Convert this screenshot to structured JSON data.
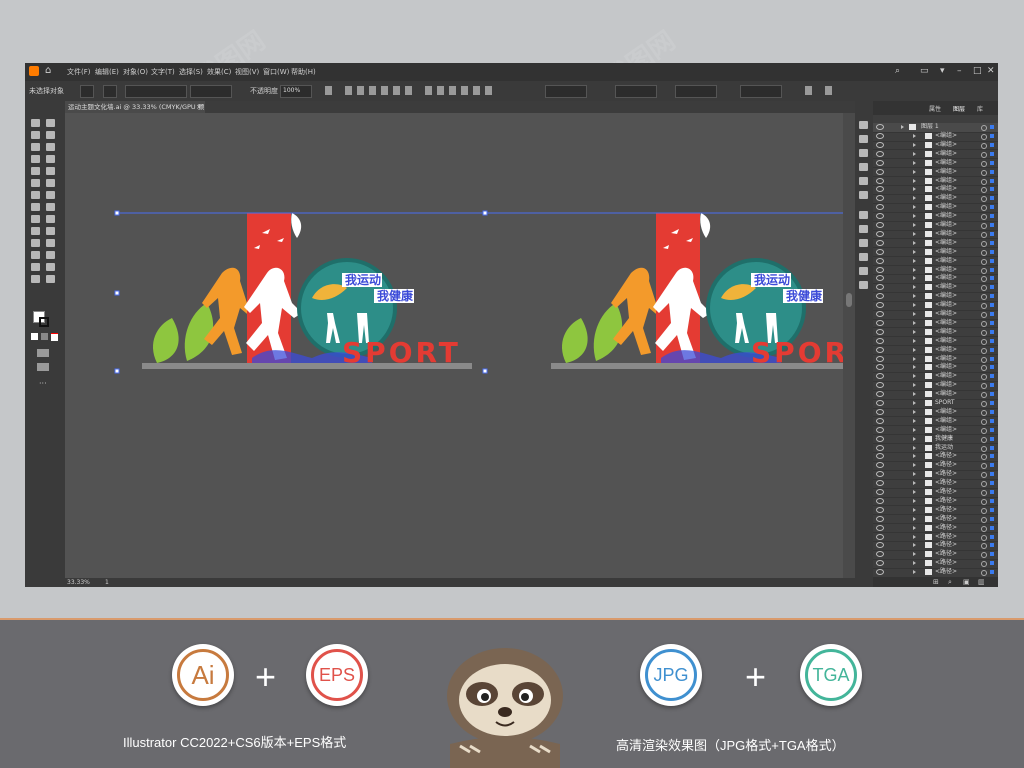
{
  "window": {
    "menus": [
      "文件(F)",
      "编辑(E)",
      "对象(O)",
      "文字(T)",
      "选择(S)",
      "效果(C)",
      "视图(V)",
      "窗口(W)",
      "帮助(H)"
    ]
  },
  "control_bar": {
    "selection_label": "未选择对象",
    "opacity_label": "不透明度",
    "opacity_value": "100%"
  },
  "document": {
    "tab_label": "运动主题文化墙.ai @ 33.33% (CMYK/GPU 预览)"
  },
  "status_bar": {
    "zoom": "33.33%",
    "page": "1"
  },
  "artwork": {
    "slogan_line1": "我运动",
    "slogan_line2": "我健康",
    "sport_text": "SPORT",
    "colors": {
      "red": "#e43b33",
      "orange": "#f39a2b",
      "teal": "#1f8a84",
      "green": "#8ec63f",
      "blue": "#3c4bd8"
    }
  },
  "layers_panel": {
    "tabs": [
      "属性",
      "图层",
      "库"
    ],
    "layer_name": "图层 1",
    "rows": [
      "<编组>",
      "<编组>",
      "<编组>",
      "<编组>",
      "<编组>",
      "<编组>",
      "<编组>",
      "<编组>",
      "<编组>",
      "<编组>",
      "<编组>",
      "<编组>",
      "<编组>",
      "<编组>",
      "<编组>",
      "<编组>",
      "<编组>",
      "<编组>",
      "<编组>",
      "<编组>",
      "<编组>",
      "<编组>",
      "<编组>",
      "<编组>",
      "<编组>",
      "<编组>",
      "<编组>",
      "<编组>",
      "<编组>",
      "<编组>",
      "SPORT",
      "<编组>",
      "<编组>",
      "<编组>",
      "我健康",
      "我运动",
      "<路径>",
      "<路径>",
      "<路径>",
      "<路径>",
      "<路径>",
      "<路径>",
      "<路径>",
      "<路径>",
      "<路径>",
      "<路径>",
      "<路径>",
      "<路径>",
      "<路径>",
      "<路径>"
    ]
  },
  "promo": {
    "badges": [
      "Ai",
      "EPS",
      "JPG",
      "TGA"
    ],
    "plus": "+",
    "caption_left": "Illustrator CC2022+CS6版本+EPS格式",
    "caption_right": "高清渲染效果图（JPG格式+TGA格式）",
    "watermark": "我图网"
  }
}
